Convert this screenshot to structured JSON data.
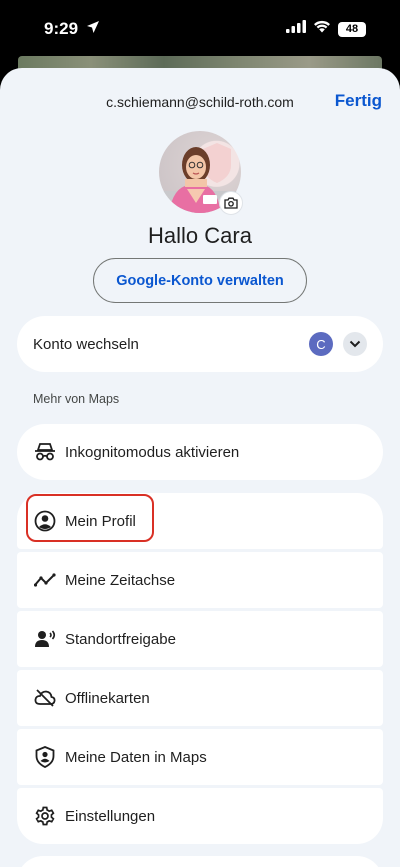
{
  "status": {
    "time": "9:29",
    "battery": "48"
  },
  "header": {
    "email": "c.schiemann@schild-roth.com",
    "done_label": "Fertig"
  },
  "profile": {
    "greeting": "Hallo Cara",
    "manage_account_label": "Google-Konto verwalten"
  },
  "switch_account": {
    "label": "Konto wechseln",
    "avatar_letter": "C"
  },
  "section": {
    "more_from_maps": "Mehr von Maps"
  },
  "incognito": {
    "label": "Inkognitomodus aktivieren"
  },
  "menu": {
    "items": [
      {
        "label": "Mein Profil",
        "icon": "account-circle-icon"
      },
      {
        "label": "Meine Zeitachse",
        "icon": "timeline-icon"
      },
      {
        "label": "Standortfreigabe",
        "icon": "location-sharing-icon"
      },
      {
        "label": "Offlinekarten",
        "icon": "cloud-off-icon"
      },
      {
        "label": "Meine Daten in Maps",
        "icon": "shield-person-icon"
      },
      {
        "label": "Einstellungen",
        "icon": "gear-icon"
      }
    ]
  },
  "colors": {
    "accent": "#0b57d0",
    "sheet": "#f0f4f9",
    "highlight": "#d93025"
  }
}
